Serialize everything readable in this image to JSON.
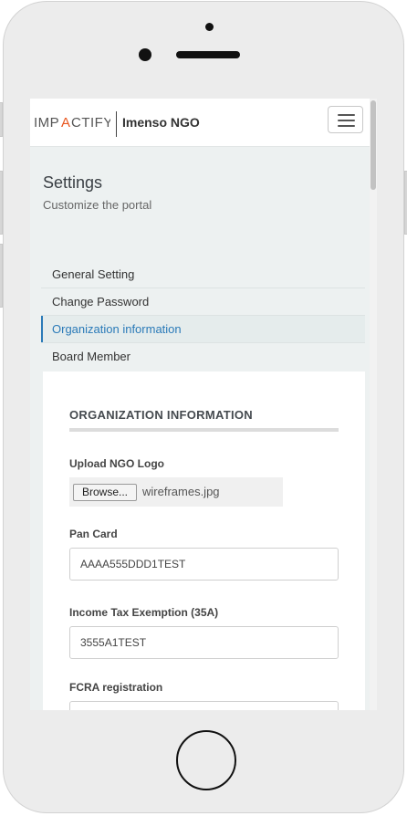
{
  "header": {
    "logo_text": "IMPACTIFY",
    "org_name": "Imenso NGO"
  },
  "page": {
    "title": "Settings",
    "subtitle": "Customize the portal"
  },
  "settings_nav": {
    "items": [
      {
        "label": "General Setting",
        "active": false
      },
      {
        "label": "Change Password",
        "active": false
      },
      {
        "label": "Organization information",
        "active": true
      },
      {
        "label": "Board Member",
        "active": false
      }
    ]
  },
  "org_form": {
    "heading": "ORGANIZATION INFORMATION",
    "logo_upload": {
      "label": "Upload NGO Logo",
      "button_label": "Browse...",
      "file_name": "wireframes.jpg"
    },
    "pan_card": {
      "label": "Pan Card",
      "value": "AAAA555DDD1TEST"
    },
    "income_tax": {
      "label": "Income Tax Exemption (35A)",
      "value": "3555A1TEST"
    },
    "fcra": {
      "label": "FCRA registration",
      "value": ""
    }
  },
  "colors": {
    "accent": "#2a7ab8",
    "logo_accent": "#e8561f",
    "screen_bg": "#edf1f1"
  }
}
